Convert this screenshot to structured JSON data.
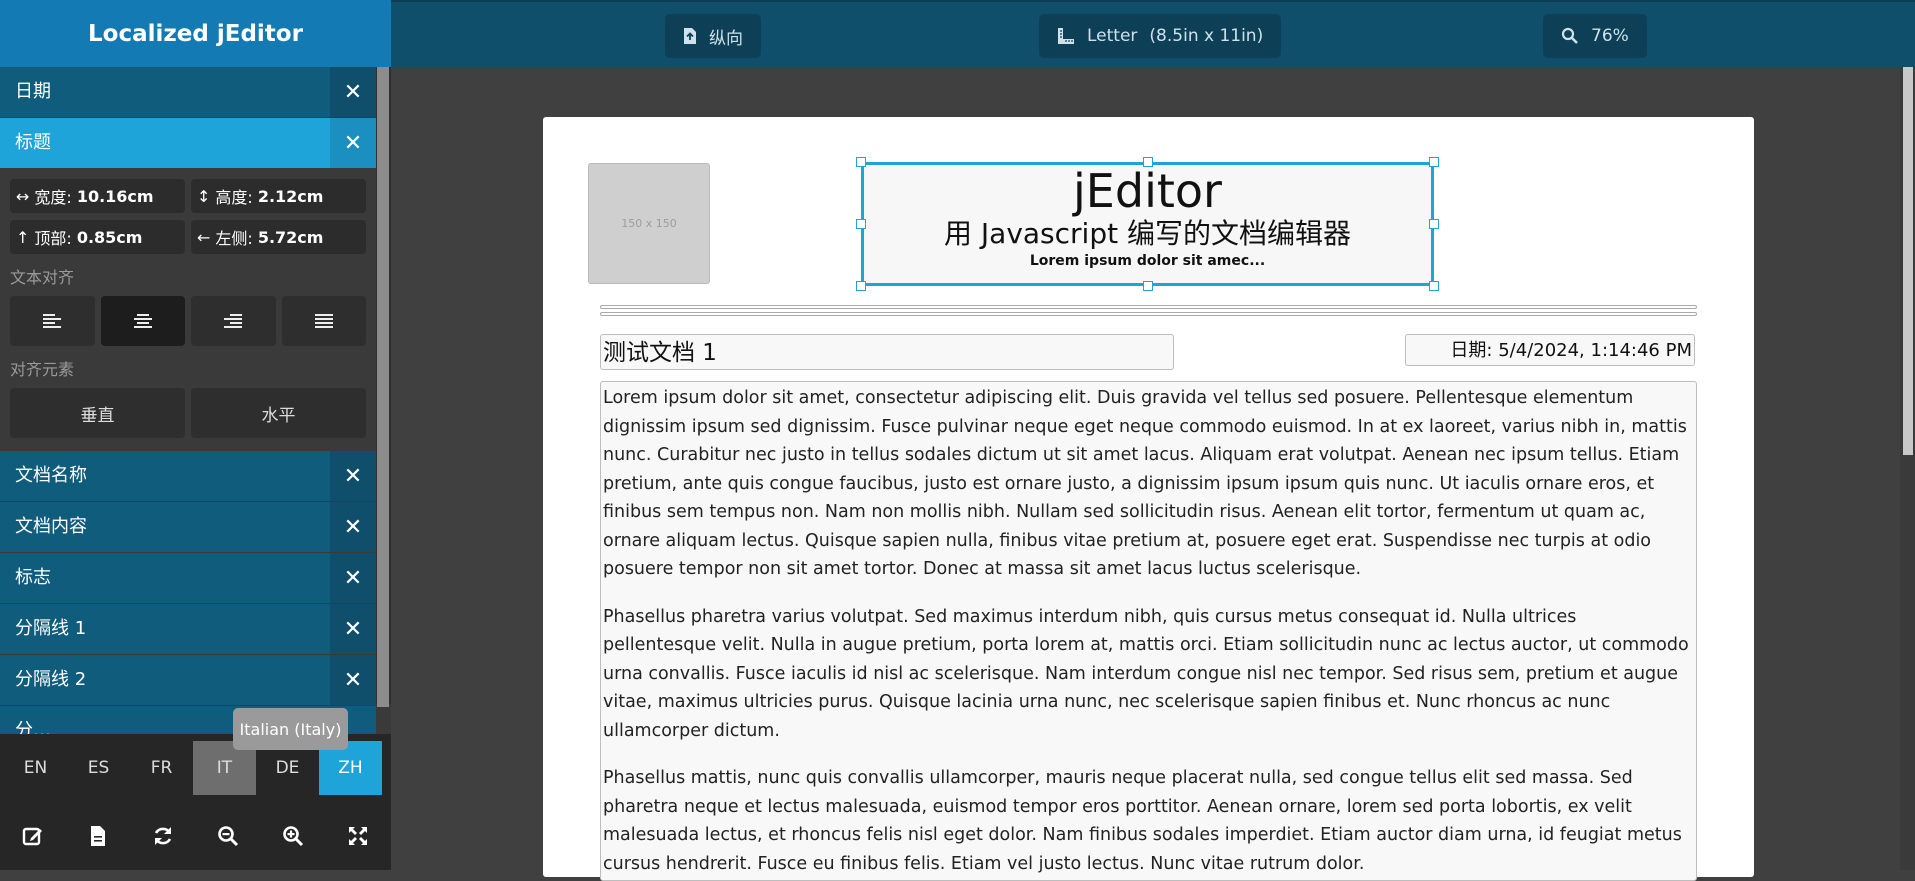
{
  "app": {
    "title": "Localized jEditor"
  },
  "sidebar": {
    "top_items": [
      {
        "label": "日期"
      },
      {
        "label": "标题"
      }
    ],
    "props": {
      "width_label": "宽度:",
      "width_value": "10.16cm",
      "height_label": "高度:",
      "height_value": "2.12cm",
      "top_label": "顶部:",
      "top_value": "0.85cm",
      "left_label": "左侧:",
      "left_value": "5.72cm"
    },
    "text_align_label": "文本对齐",
    "align_element_label": "对齐元素",
    "align_element_buttons": {
      "vertical": "垂直",
      "horizontal": "水平"
    },
    "items": [
      {
        "label": "文档名称"
      },
      {
        "label": "文档内容"
      },
      {
        "label": "标志"
      },
      {
        "label": "分隔线 1"
      },
      {
        "label": "分隔线 2"
      }
    ],
    "partial_item": "分…"
  },
  "languages": [
    "EN",
    "ES",
    "FR",
    "IT",
    "DE",
    "ZH"
  ],
  "active_language": "ZH",
  "tooltip": "Italian (Italy)",
  "tools": [
    "edit-icon",
    "new-document-icon",
    "refresh-icon",
    "zoom-out-icon",
    "zoom-in-icon",
    "fullscreen-icon"
  ],
  "topbar": {
    "orientation": "纵向",
    "paper": "Letter",
    "paper_size": "(8.5in x 11in)",
    "zoom": "76%"
  },
  "document": {
    "logo_placeholder": "150 x 150",
    "title_main": "jEditor",
    "title_sub": "用 Javascript 编写的文档编辑器",
    "title_tag": "Lorem ipsum dolor sit amec...",
    "name": "测试文档 1",
    "date": "日期: 5/4/2024, 1:14:46 PM",
    "paragraphs": [
      "Lorem ipsum dolor sit amet, consectetur adipiscing elit. Duis gravida vel tellus sed posuere. Pellentesque elementum dignissim ipsum sed dignissim. Fusce pulvinar neque eget neque commodo euismod. In at ex laoreet, varius nibh in, mattis nunc. Curabitur nec justo in tellus sodales dictum ut sit amet lacus. Aliquam erat volutpat. Aenean nec ipsum tellus. Etiam pretium, ante quis congue faucibus, justo est ornare justo, a dignissim ipsum ipsum quis nunc. Ut iaculis ornare eros, et finibus sem tempus non. Nam non mollis nibh. Nullam sed sollicitudin risus. Aenean elit tortor, fermentum ut quam ac, ornare aliquam lectus. Quisque sapien nulla, finibus vitae pretium at, posuere eget erat. Suspendisse nec turpis at odio posuere tempor non sit amet tortor. Donec at massa sit amet lacus luctus scelerisque.",
      "Phasellus pharetra varius volutpat. Sed maximus interdum nibh, quis cursus metus consequat id. Nulla ultrices pellentesque velit. Nulla in augue pretium, porta lorem at, mattis orci. Etiam sollicitudin nunc ac lectus auctor, ut commodo urna convallis. Fusce iaculis id nisl ac scelerisque. Nam interdum congue nisl nec tempor. Sed risus sem, pretium et augue vitae, maximus ultricies purus. Quisque lacinia urna nunc, nec scelerisque sapien finibus et. Nunc rhoncus ac nunc ullamcorper dictum.",
      "Phasellus mattis, nunc quis convallis ullamcorper, mauris neque placerat nulla, sed congue tellus elit sed massa. Sed pharetra neque et lectus malesuada, euismod tempor eros porttitor. Aenean ornare, lorem sed porta lobortis, ex velit malesuada lectus, et rhoncus felis nisl eget dolor. Nam finibus sodales imperdiet. Etiam auctor diam urna, id feugiat metus cursus hendrerit. Fusce eu finibus felis. Etiam vel justo lectus. Nunc vitae rutrum dolor."
    ]
  }
}
